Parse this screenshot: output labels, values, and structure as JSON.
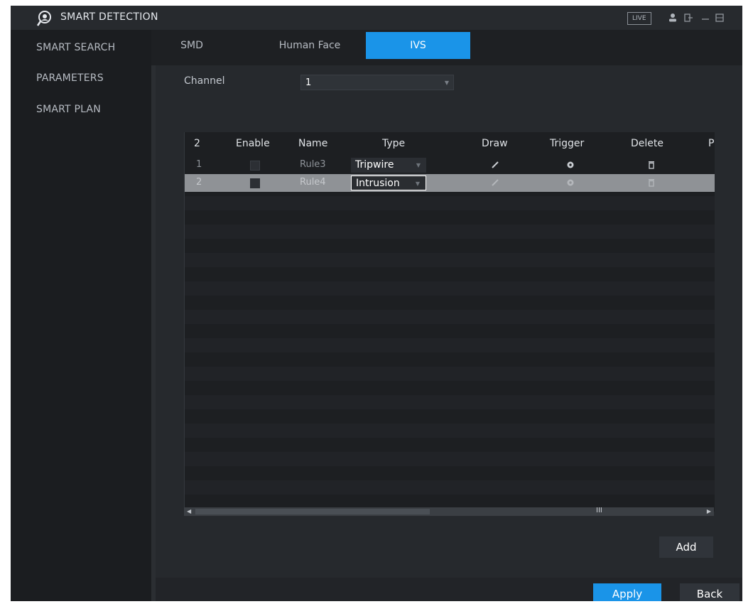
{
  "header": {
    "title": "SMART DETECTION",
    "live_label": "LIVE"
  },
  "sidebar": {
    "items": [
      {
        "label": "SMART SEARCH"
      },
      {
        "label": "PARAMETERS"
      },
      {
        "label": "SMART PLAN"
      }
    ]
  },
  "tabs": [
    {
      "label": "SMD",
      "active": false
    },
    {
      "label": "Human Face",
      "active": false
    },
    {
      "label": "IVS",
      "active": true
    }
  ],
  "channel": {
    "label": "Channel",
    "value": "1"
  },
  "table": {
    "columns": [
      "2",
      "Enable",
      "Name",
      "Type",
      "Draw",
      "Trigger",
      "Delete",
      "P"
    ],
    "rows": [
      {
        "index": "1",
        "enabled": false,
        "name": "Rule3",
        "type": "Tripwire",
        "selected": false
      },
      {
        "index": "2",
        "enabled": true,
        "name": "Rule4",
        "type": "Intrusion",
        "selected": true
      }
    ]
  },
  "scrollbar_grip": "III",
  "buttons": {
    "add": "Add",
    "apply": "Apply",
    "back": "Back"
  },
  "colors": {
    "accent": "#1a94e8",
    "background": "#1e2023",
    "selected_row": "#8f9296"
  }
}
